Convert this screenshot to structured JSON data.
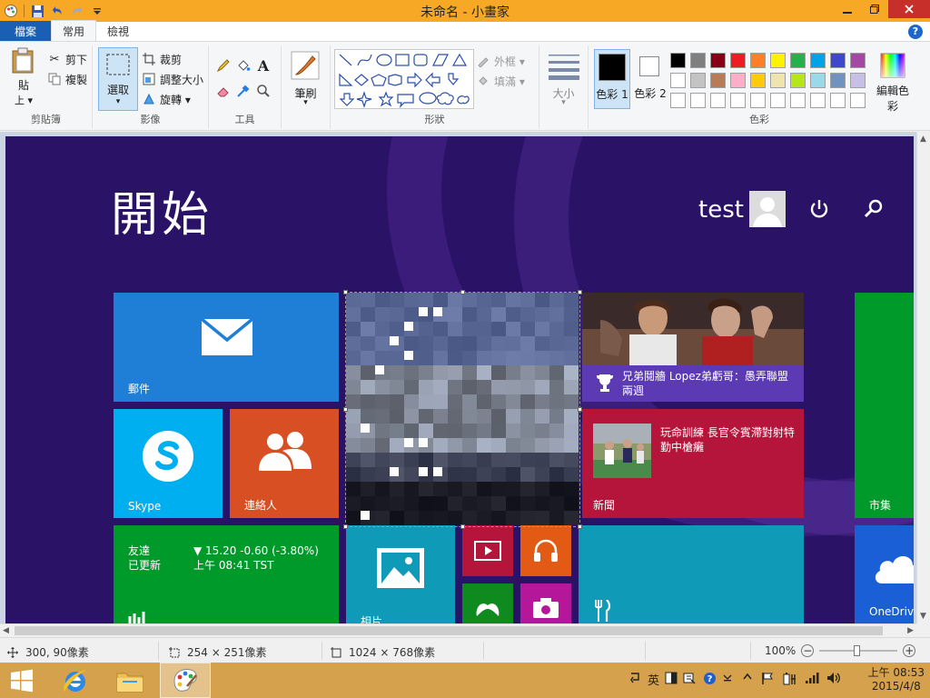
{
  "window": {
    "title": "未命名 - 小畫家"
  },
  "quick_access": {
    "icons": [
      "paint-app-icon",
      "save-icon",
      "undo-icon",
      "redo-icon",
      "customize-icon"
    ]
  },
  "tabs": [
    {
      "label": "檔案"
    },
    {
      "label": "常用"
    },
    {
      "label": "檢視"
    }
  ],
  "ribbon": {
    "clipboard": {
      "paste": "貼",
      "paste_sub": "上",
      "cut": "剪下",
      "copy": "複製",
      "label": "剪貼簿"
    },
    "image": {
      "select": "選取",
      "crop": "裁剪",
      "resize": "調整大小",
      "rotate": "旋轉",
      "label": "影像"
    },
    "tools": {
      "label": "工具"
    },
    "brushes": {
      "label": "筆刷"
    },
    "shapes": {
      "outline": "外框",
      "fill": "填滿",
      "label": "形狀"
    },
    "size": {
      "label": "大小"
    },
    "colors": {
      "color1": "色彩 1",
      "color2": "色彩 2",
      "edit": "編輯色彩",
      "label": "色彩",
      "color1_value": "#000000",
      "color2_value": "#ffffff",
      "palette_row1": [
        "#000000",
        "#7f7f7f",
        "#880015",
        "#ed1c24",
        "#ff7f27",
        "#fff200",
        "#22b14c",
        "#00a2e8",
        "#3f48cc",
        "#a349a4"
      ],
      "palette_row2": [
        "#ffffff",
        "#c3c3c3",
        "#b97a57",
        "#ffaec9",
        "#ffc90e",
        "#efe4b0",
        "#b5e61d",
        "#99d9ea",
        "#7092be",
        "#c8bfe7"
      ],
      "palette_row3": [
        "#ffffff",
        "#ffffff",
        "#ffffff",
        "#ffffff",
        "#ffffff",
        "#ffffff",
        "#ffffff",
        "#ffffff",
        "#ffffff",
        "#ffffff"
      ]
    }
  },
  "startscreen": {
    "title": "開始",
    "user": "test",
    "tiles": {
      "mail": {
        "label": "郵件",
        "color": "#1f7ed6"
      },
      "skype": {
        "label": "Skype",
        "color": "#00aff0"
      },
      "people": {
        "label": "連絡人",
        "color": "#d94f24"
      },
      "finance": {
        "label1": "友達",
        "label2": "已更新",
        "quote": "▼ 15.20  -0.60 (-3.80%)",
        "time": "上午 08:41 TST",
        "color": "#009a2a"
      },
      "sports": {
        "headline": "兄弟鬩牆 Lopez弟虧哥：愚弄聯盟兩週",
        "color": "#5b3ab3"
      },
      "news": {
        "headline": "玩命訓練 長官令賓滯對射特勤中槍癱",
        "label": "新聞",
        "color": "#b5153a"
      },
      "store": {
        "label": "市集",
        "color": "#009a2a"
      },
      "photos": {
        "label": "相片",
        "color": "#0f9bb8"
      },
      "video": {
        "color": "#b5153a"
      },
      "music": {
        "color": "#e35a14"
      },
      "games": {
        "color": "#0f8a1e"
      },
      "camera": {
        "color": "#b4179a"
      },
      "food": {
        "color": "#0f9bb8"
      },
      "onedrive": {
        "label": "OneDrive",
        "color": "#1a5fd6"
      }
    }
  },
  "status": {
    "cursor": "300, 90像素",
    "selection": "254 × 251像素",
    "image": "1024 × 768像素",
    "zoom": "100%"
  },
  "tray": {
    "ime": "英",
    "time": "上午 08:53",
    "date": "2015/4/8"
  }
}
